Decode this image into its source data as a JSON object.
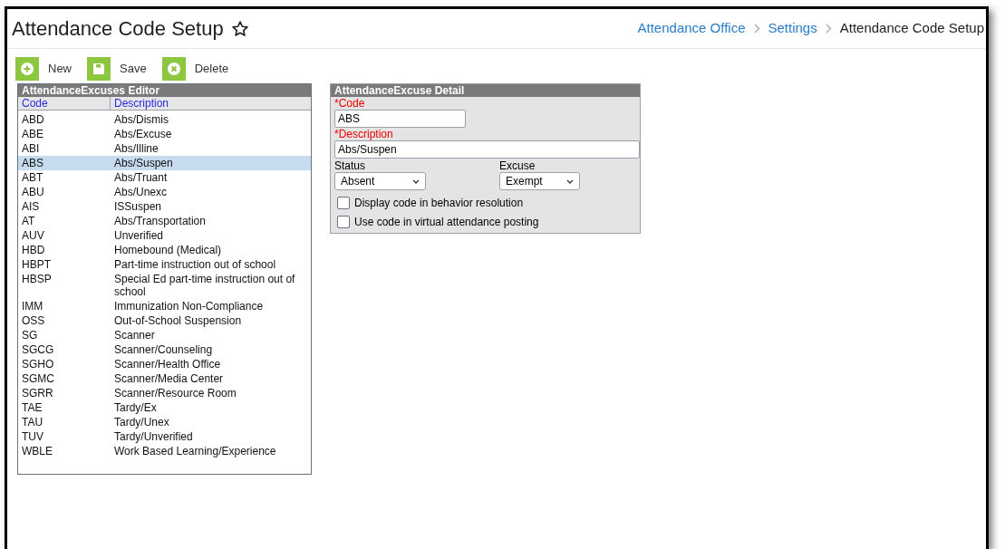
{
  "page": {
    "title": "Attendance Code Setup",
    "favorite": false
  },
  "breadcrumbs": [
    {
      "label": "Attendance Office",
      "link": true
    },
    {
      "label": "Settings",
      "link": true
    },
    {
      "label": "Attendance Code Setup",
      "link": false
    }
  ],
  "toolbar": [
    {
      "label": "New",
      "kind": "new"
    },
    {
      "label": "Save",
      "kind": "save"
    },
    {
      "label": "Delete",
      "kind": "delete"
    }
  ],
  "editor": {
    "title": "AttendanceExcuses Editor",
    "columns": [
      "Code",
      "Description"
    ],
    "rows": [
      {
        "code": "ABD",
        "description": "Abs/Dismis",
        "selected": false
      },
      {
        "code": "ABE",
        "description": "Abs/Excuse",
        "selected": false
      },
      {
        "code": "ABI",
        "description": "Abs/Illine",
        "selected": false
      },
      {
        "code": "ABS",
        "description": "Abs/Suspen",
        "selected": true
      },
      {
        "code": "ABT",
        "description": "Abs/Truant",
        "selected": false
      },
      {
        "code": "ABU",
        "description": "Abs/Unexc",
        "selected": false
      },
      {
        "code": "AIS",
        "description": "ISSuspen",
        "selected": false
      },
      {
        "code": "AT",
        "description": "Abs/Transportation",
        "selected": false
      },
      {
        "code": "AUV",
        "description": "Unverified",
        "selected": false
      },
      {
        "code": "HBD",
        "description": "Homebound (Medical)",
        "selected": false
      },
      {
        "code": "HBPT",
        "description": "Part-time instruction out of school",
        "selected": false
      },
      {
        "code": "HBSP",
        "description": "Special Ed part-time instruction out of school",
        "selected": false
      },
      {
        "code": "IMM",
        "description": "Immunization Non-Compliance",
        "selected": false
      },
      {
        "code": "OSS",
        "description": "Out-of-School Suspension",
        "selected": false
      },
      {
        "code": "SG",
        "description": "Scanner",
        "selected": false
      },
      {
        "code": "SGCG",
        "description": "Scanner/Counseling",
        "selected": false
      },
      {
        "code": "SGHO",
        "description": "Scanner/Health Office",
        "selected": false
      },
      {
        "code": "SGMC",
        "description": "Scanner/Media Center",
        "selected": false
      },
      {
        "code": "SGRR",
        "description": "Scanner/Resource Room",
        "selected": false
      },
      {
        "code": "TAE",
        "description": "Tardy/Ex",
        "selected": false
      },
      {
        "code": "TAU",
        "description": "Tardy/Unex",
        "selected": false
      },
      {
        "code": "TUV",
        "description": "Tardy/Unverified",
        "selected": false
      },
      {
        "code": "WBLE",
        "description": "Work Based Learning/Experience",
        "selected": false
      }
    ]
  },
  "detail": {
    "title": "AttendanceExcuse Detail",
    "code": {
      "label": "*Code",
      "value": "ABS"
    },
    "description": {
      "label": "*Description",
      "value": "Abs/Suspen"
    },
    "status": {
      "label": "Status",
      "value": "Absent"
    },
    "excuse": {
      "label": "Excuse",
      "value": "Exempt"
    },
    "checkboxes": [
      {
        "label": "Display code in behavior resolution",
        "checked": false
      },
      {
        "label": "Use code in virtual attendance posting",
        "checked": false
      }
    ]
  }
}
